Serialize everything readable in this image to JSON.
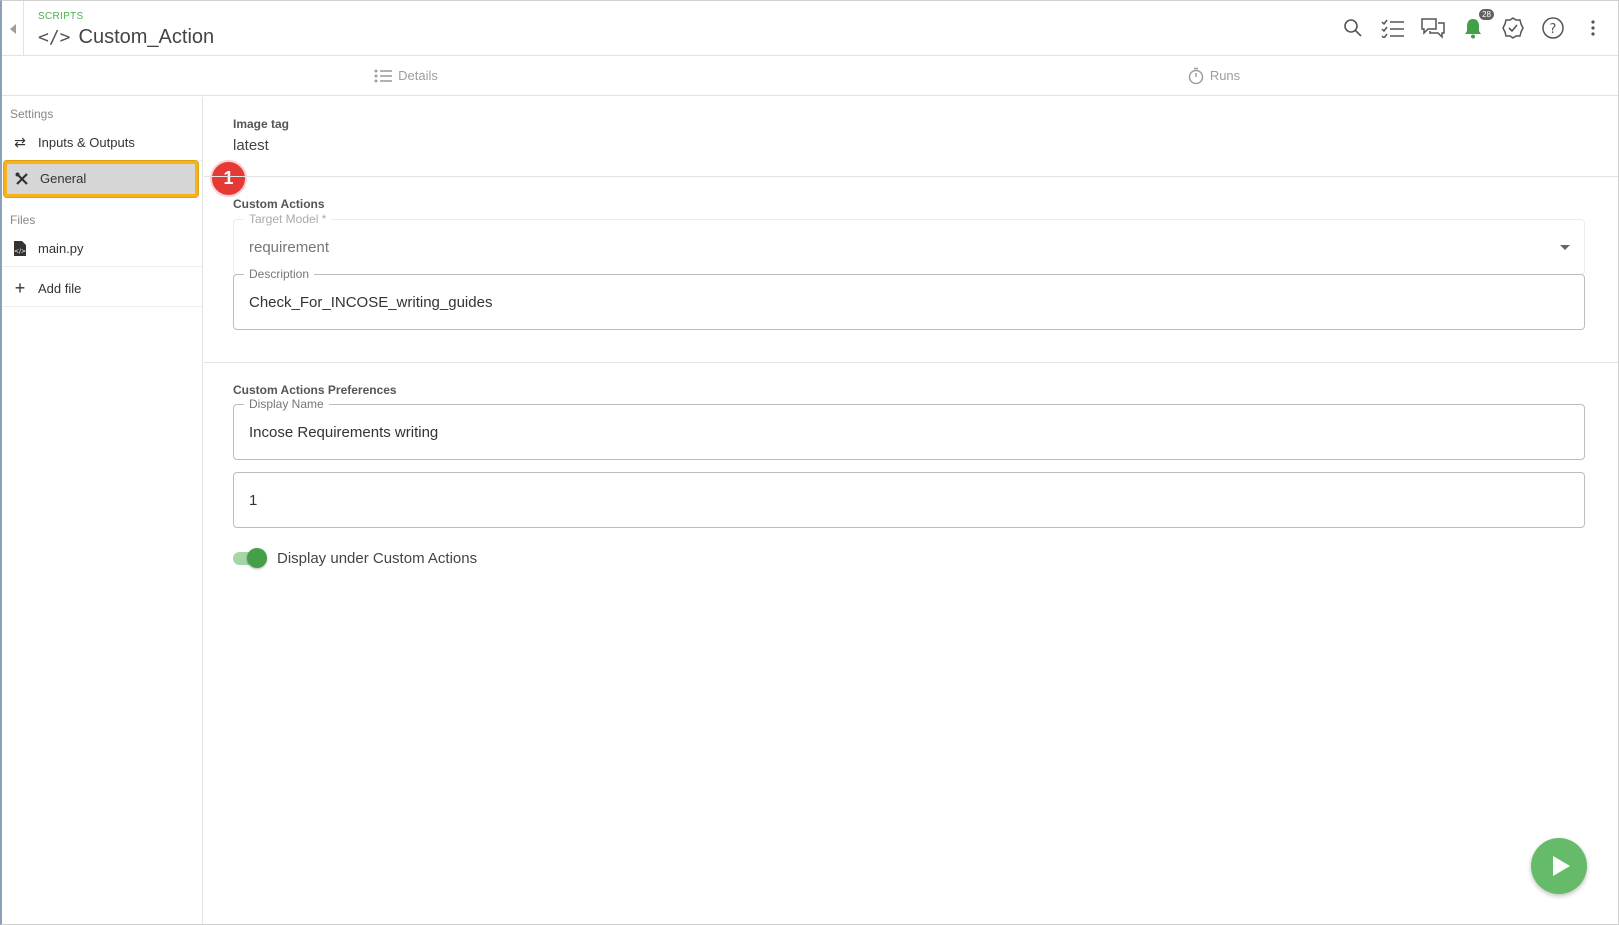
{
  "header": {
    "breadcrumb": "SCRIPTS",
    "title": "Custom_Action",
    "notification_count": "28",
    "accent_color": "#4caf50"
  },
  "tabs": [
    {
      "label": "Details",
      "icon": "list-icon"
    },
    {
      "label": "Runs",
      "icon": "stopwatch-icon"
    }
  ],
  "sidebar": {
    "settings_label": "Settings",
    "settings_items": [
      {
        "label": "Inputs & Outputs",
        "icon": "swap-arrows-icon"
      },
      {
        "label": "General",
        "icon": "tools-icon",
        "active": true
      }
    ],
    "files_label": "Files",
    "file_items": [
      {
        "label": "main.py",
        "icon": "file-code-icon"
      }
    ],
    "add_file_label": "Add file",
    "callout_number": "1"
  },
  "main": {
    "image_tag": {
      "label": "Image tag",
      "value": "latest"
    },
    "custom_actions": {
      "label": "Custom Actions",
      "target_model": {
        "label": "Target Model *",
        "value": "requirement"
      },
      "description": {
        "label": "Description",
        "value": "Check_For_INCOSE_writing_guides"
      }
    },
    "preferences": {
      "label": "Custom Actions Preferences",
      "display_name": {
        "label": "Display Name",
        "value": "Incose Requirements writing"
      },
      "order": {
        "value": "1"
      },
      "display_toggle": {
        "label": "Display under Custom Actions",
        "on": true
      }
    }
  }
}
